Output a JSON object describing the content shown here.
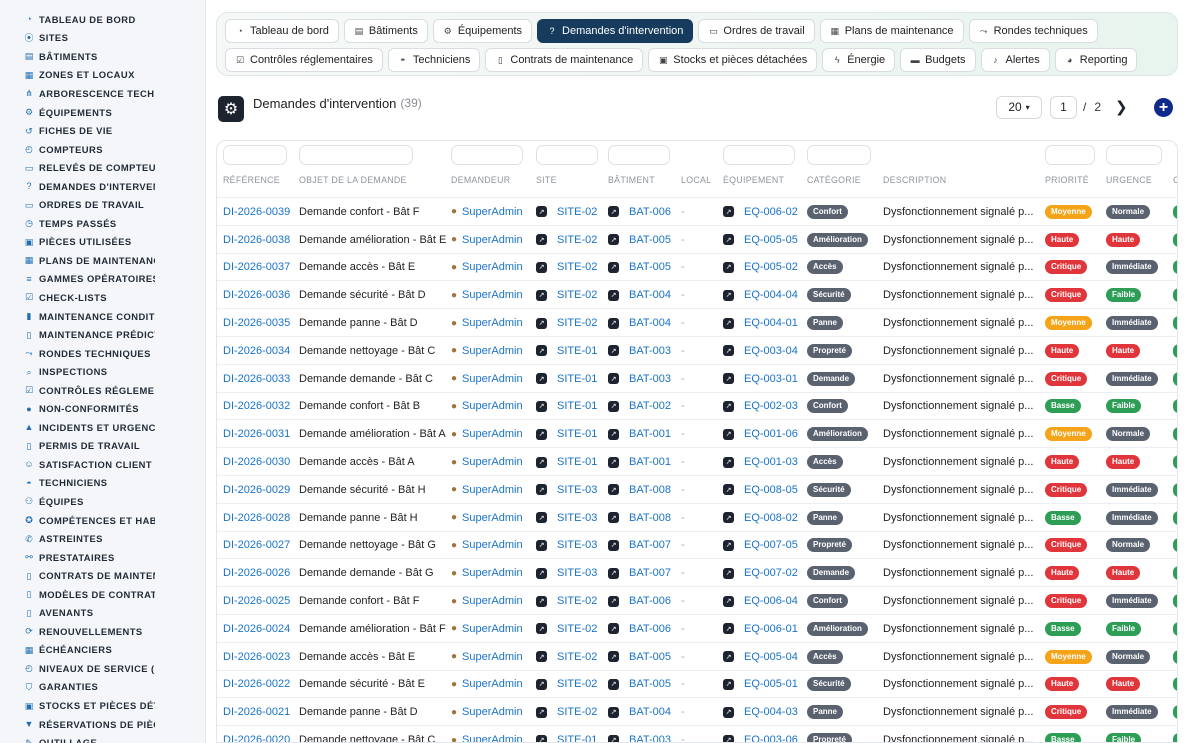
{
  "sidebar": {
    "items": [
      {
        "label": "TABLEAU DE BORD",
        "icon": "dashboard-icon"
      },
      {
        "label": "SITES",
        "icon": "pin-icon"
      },
      {
        "label": "BÂTIMENTS",
        "icon": "building-icon"
      },
      {
        "label": "ZONES ET LOCAUX",
        "icon": "grid-icon"
      },
      {
        "label": "ARBORESCENCE TECHNI",
        "icon": "tree-icon"
      },
      {
        "label": "ÉQUIPEMENTS",
        "icon": "gears-icon"
      },
      {
        "label": "FICHES DE VIE",
        "icon": "history-icon"
      },
      {
        "label": "COMPTEURS",
        "icon": "gauge-icon"
      },
      {
        "label": "RELEVÉS DE COMPTEURS",
        "icon": "clipboard-icon"
      },
      {
        "label": "DEMANDES D'INTERVENT",
        "icon": "question-icon"
      },
      {
        "label": "ORDRES DE TRAVAIL",
        "icon": "clipboard-icon"
      },
      {
        "label": "TEMPS PASSÉS",
        "icon": "clock-icon"
      },
      {
        "label": "PIÈCES UTILISÉES",
        "icon": "cubes-icon"
      },
      {
        "label": "PLANS DE MAINTENANCE",
        "icon": "calendar-icon"
      },
      {
        "label": "GAMMES OPÉRATOIRES",
        "icon": "list-icon"
      },
      {
        "label": "CHECK-LISTS",
        "icon": "checklist-icon"
      },
      {
        "label": "MAINTENANCE CONDITIO",
        "icon": "thermometer-icon"
      },
      {
        "label": "MAINTENANCE PRÉDICTI",
        "icon": "chart-icon"
      },
      {
        "label": "RONDES TECHNIQUES",
        "icon": "route-icon"
      },
      {
        "label": "INSPECTIONS",
        "icon": "search-icon"
      },
      {
        "label": "CONTRÔLES RÉGLEMENT",
        "icon": "clipboard-check-icon"
      },
      {
        "label": "NON-CONFORMITÉS",
        "icon": "alert-circle-icon"
      },
      {
        "label": "INCIDENTS ET URGENCES",
        "icon": "warning-icon"
      },
      {
        "label": "PERMIS DE TRAVAIL",
        "icon": "file-icon"
      },
      {
        "label": "SATISFACTION CLIENT",
        "icon": "smile-icon"
      },
      {
        "label": "TECHNICIENS",
        "icon": "helmet-icon"
      },
      {
        "label": "ÉQUIPES",
        "icon": "users-icon"
      },
      {
        "label": "COMPÉTENCES ET HABIL",
        "icon": "certificate-icon"
      },
      {
        "label": "ASTREINTES",
        "icon": "phone-icon"
      },
      {
        "label": "PRESTATAIRES",
        "icon": "handshake-icon"
      },
      {
        "label": "CONTRATS DE MAINTENA",
        "icon": "file-contract-icon"
      },
      {
        "label": "MODÈLES DE CONTRATS",
        "icon": "file-icon"
      },
      {
        "label": "AVENANTS",
        "icon": "file-plus-icon"
      },
      {
        "label": "RENOUVELLEMENTS",
        "icon": "refresh-icon"
      },
      {
        "label": "ÉCHÉANCIERS",
        "icon": "calendar-icon"
      },
      {
        "label": "NIVEAUX DE SERVICE (SL",
        "icon": "gauge-icon"
      },
      {
        "label": "GARANTIES",
        "icon": "shield-icon"
      },
      {
        "label": "STOCKS ET PIÈCES DÉTA",
        "icon": "cubes-icon"
      },
      {
        "label": "RÉSERVATIONS DE PIÈCE",
        "icon": "bookmark-icon"
      },
      {
        "label": "OUTILLAGE",
        "icon": "tools-icon"
      }
    ]
  },
  "topnav": {
    "row1": [
      {
        "label": "Tableau de bord",
        "icon": "dashboard-icon"
      },
      {
        "label": "Bâtiments",
        "icon": "building-icon"
      },
      {
        "label": "Équipements",
        "icon": "gears-icon"
      },
      {
        "label": "Demandes d'intervention",
        "icon": "question-icon",
        "active": true
      },
      {
        "label": "Ordres de travail",
        "icon": "clipboard-icon"
      },
      {
        "label": "Plans de maintenance",
        "icon": "calendar-icon"
      },
      {
        "label": "Rondes techniques",
        "icon": "route-icon"
      }
    ],
    "row2": [
      {
        "label": "Contrôles réglementaires",
        "icon": "clipboard-check-icon"
      },
      {
        "label": "Techniciens",
        "icon": "helmet-icon"
      },
      {
        "label": "Contrats de maintenance",
        "icon": "file-contract-icon"
      },
      {
        "label": "Stocks et pièces détachées",
        "icon": "cubes-icon"
      },
      {
        "label": "Énergie",
        "icon": "bolt-icon"
      },
      {
        "label": "Budgets",
        "icon": "money-icon"
      },
      {
        "label": "Alertes",
        "icon": "bell-icon"
      },
      {
        "label": "Reporting",
        "icon": "pie-icon"
      }
    ]
  },
  "header": {
    "title": "Demandes d'intervention",
    "count": "(39)",
    "icon": "gears-icon"
  },
  "pagination": {
    "per_page": "20",
    "current": "1",
    "separator": "/",
    "total": "2",
    "next_icon": "chevron-right-icon",
    "add_icon": "plus-circle-icon"
  },
  "table": {
    "columns": [
      "RÉFÉRENCE",
      "OBJET DE LA DEMANDE",
      "DEMANDEUR",
      "SITE",
      "BÂTIMENT",
      "LOCAL",
      "ÉQUIPEMENT",
      "CATÉGORIE",
      "DESCRIPTION",
      "PRIORITÉ",
      "URGENCE",
      "C"
    ],
    "colors": {
      "Moyenne": "#f5a318",
      "Haute": "#e0353a",
      "Critique": "#e0353a",
      "Basse": "#2e9e57",
      "Normale": "#5a6270",
      "Immédiate": "#5a6270",
      "Faible": "#2e9e57"
    },
    "rows": [
      {
        "ref": "DI-2026-0039",
        "objet": "Demande confort - Bât F",
        "demandeur": "SuperAdmin",
        "site": "SITE-02",
        "batiment": "BAT-006",
        "local": "-",
        "equipement": "EQ-006-02",
        "categorie": "Confort",
        "description": "Dysfonctionnement signalé p...",
        "priorite": "Moyenne",
        "urgence": "Normale"
      },
      {
        "ref": "DI-2026-0038",
        "objet": "Demande amélioration - Bât E",
        "demandeur": "SuperAdmin",
        "site": "SITE-02",
        "batiment": "BAT-005",
        "local": "-",
        "equipement": "EQ-005-05",
        "categorie": "Amélioration",
        "description": "Dysfonctionnement signalé p...",
        "priorite": "Haute",
        "urgence": "Haute"
      },
      {
        "ref": "DI-2026-0037",
        "objet": "Demande accès - Bât E",
        "demandeur": "SuperAdmin",
        "site": "SITE-02",
        "batiment": "BAT-005",
        "local": "-",
        "equipement": "EQ-005-02",
        "categorie": "Accès",
        "description": "Dysfonctionnement signalé p...",
        "priorite": "Critique",
        "urgence": "Immédiate"
      },
      {
        "ref": "DI-2026-0036",
        "objet": "Demande sécurité - Bât D",
        "demandeur": "SuperAdmin",
        "site": "SITE-02",
        "batiment": "BAT-004",
        "local": "-",
        "equipement": "EQ-004-04",
        "categorie": "Sécurité",
        "description": "Dysfonctionnement signalé p...",
        "priorite": "Critique",
        "urgence": "Faible"
      },
      {
        "ref": "DI-2026-0035",
        "objet": "Demande panne - Bât D",
        "demandeur": "SuperAdmin",
        "site": "SITE-02",
        "batiment": "BAT-004",
        "local": "-",
        "equipement": "EQ-004-01",
        "categorie": "Panne",
        "description": "Dysfonctionnement signalé p...",
        "priorite": "Moyenne",
        "urgence": "Immédiate"
      },
      {
        "ref": "DI-2026-0034",
        "objet": "Demande nettoyage - Bât C",
        "demandeur": "SuperAdmin",
        "site": "SITE-01",
        "batiment": "BAT-003",
        "local": "-",
        "equipement": "EQ-003-04",
        "categorie": "Propreté",
        "description": "Dysfonctionnement signalé p...",
        "priorite": "Haute",
        "urgence": "Haute"
      },
      {
        "ref": "DI-2026-0033",
        "objet": "Demande demande - Bât C",
        "demandeur": "SuperAdmin",
        "site": "SITE-01",
        "batiment": "BAT-003",
        "local": "-",
        "equipement": "EQ-003-01",
        "categorie": "Demande",
        "description": "Dysfonctionnement signalé p...",
        "priorite": "Critique",
        "urgence": "Immédiate"
      },
      {
        "ref": "DI-2026-0032",
        "objet": "Demande confort - Bât B",
        "demandeur": "SuperAdmin",
        "site": "SITE-01",
        "batiment": "BAT-002",
        "local": "-",
        "equipement": "EQ-002-03",
        "categorie": "Confort",
        "description": "Dysfonctionnement signalé p...",
        "priorite": "Basse",
        "urgence": "Faible"
      },
      {
        "ref": "DI-2026-0031",
        "objet": "Demande amélioration - Bât A",
        "demandeur": "SuperAdmin",
        "site": "SITE-01",
        "batiment": "BAT-001",
        "local": "-",
        "equipement": "EQ-001-06",
        "categorie": "Amélioration",
        "description": "Dysfonctionnement signalé p...",
        "priorite": "Moyenne",
        "urgence": "Normale"
      },
      {
        "ref": "DI-2026-0030",
        "objet": "Demande accès - Bât A",
        "demandeur": "SuperAdmin",
        "site": "SITE-01",
        "batiment": "BAT-001",
        "local": "-",
        "equipement": "EQ-001-03",
        "categorie": "Accès",
        "description": "Dysfonctionnement signalé p...",
        "priorite": "Haute",
        "urgence": "Haute"
      },
      {
        "ref": "DI-2026-0029",
        "objet": "Demande sécurité - Bât H",
        "demandeur": "SuperAdmin",
        "site": "SITE-03",
        "batiment": "BAT-008",
        "local": "-",
        "equipement": "EQ-008-05",
        "categorie": "Sécurité",
        "description": "Dysfonctionnement signalé p...",
        "priorite": "Critique",
        "urgence": "Immédiate"
      },
      {
        "ref": "DI-2026-0028",
        "objet": "Demande panne - Bât H",
        "demandeur": "SuperAdmin",
        "site": "SITE-03",
        "batiment": "BAT-008",
        "local": "-",
        "equipement": "EQ-008-02",
        "categorie": "Panne",
        "description": "Dysfonctionnement signalé p...",
        "priorite": "Basse",
        "urgence": "Immédiate"
      },
      {
        "ref": "DI-2026-0027",
        "objet": "Demande nettoyage - Bât G",
        "demandeur": "SuperAdmin",
        "site": "SITE-03",
        "batiment": "BAT-007",
        "local": "-",
        "equipement": "EQ-007-05",
        "categorie": "Propreté",
        "description": "Dysfonctionnement signalé p...",
        "priorite": "Critique",
        "urgence": "Normale"
      },
      {
        "ref": "DI-2026-0026",
        "objet": "Demande demande - Bât G",
        "demandeur": "SuperAdmin",
        "site": "SITE-03",
        "batiment": "BAT-007",
        "local": "-",
        "equipement": "EQ-007-02",
        "categorie": "Demande",
        "description": "Dysfonctionnement signalé p...",
        "priorite": "Haute",
        "urgence": "Haute"
      },
      {
        "ref": "DI-2026-0025",
        "objet": "Demande confort - Bât F",
        "demandeur": "SuperAdmin",
        "site": "SITE-02",
        "batiment": "BAT-006",
        "local": "-",
        "equipement": "EQ-006-04",
        "categorie": "Confort",
        "description": "Dysfonctionnement signalé p...",
        "priorite": "Critique",
        "urgence": "Immédiate"
      },
      {
        "ref": "DI-2026-0024",
        "objet": "Demande amélioration - Bât F",
        "demandeur": "SuperAdmin",
        "site": "SITE-02",
        "batiment": "BAT-006",
        "local": "-",
        "equipement": "EQ-006-01",
        "categorie": "Amélioration",
        "description": "Dysfonctionnement signalé p...",
        "priorite": "Basse",
        "urgence": "Faible"
      },
      {
        "ref": "DI-2026-0023",
        "objet": "Demande accès - Bât E",
        "demandeur": "SuperAdmin",
        "site": "SITE-02",
        "batiment": "BAT-005",
        "local": "-",
        "equipement": "EQ-005-04",
        "categorie": "Accès",
        "description": "Dysfonctionnement signalé p...",
        "priorite": "Moyenne",
        "urgence": "Normale"
      },
      {
        "ref": "DI-2026-0022",
        "objet": "Demande sécurité - Bât E",
        "demandeur": "SuperAdmin",
        "site": "SITE-02",
        "batiment": "BAT-005",
        "local": "-",
        "equipement": "EQ-005-01",
        "categorie": "Sécurité",
        "description": "Dysfonctionnement signalé p...",
        "priorite": "Haute",
        "urgence": "Haute"
      },
      {
        "ref": "DI-2026-0021",
        "objet": "Demande panne - Bât D",
        "demandeur": "SuperAdmin",
        "site": "SITE-02",
        "batiment": "BAT-004",
        "local": "-",
        "equipement": "EQ-004-03",
        "categorie": "Panne",
        "description": "Dysfonctionnement signalé p...",
        "priorite": "Critique",
        "urgence": "Immédiate"
      },
      {
        "ref": "DI-2026-0020",
        "objet": "Demande nettoyage - Bât C",
        "demandeur": "SuperAdmin",
        "site": "SITE-01",
        "batiment": "BAT-003",
        "local": "-",
        "equipement": "EQ-003-06",
        "categorie": "Propreté",
        "description": "Dysfonctionnement signalé p...",
        "priorite": "Basse",
        "urgence": "Faible"
      }
    ]
  }
}
